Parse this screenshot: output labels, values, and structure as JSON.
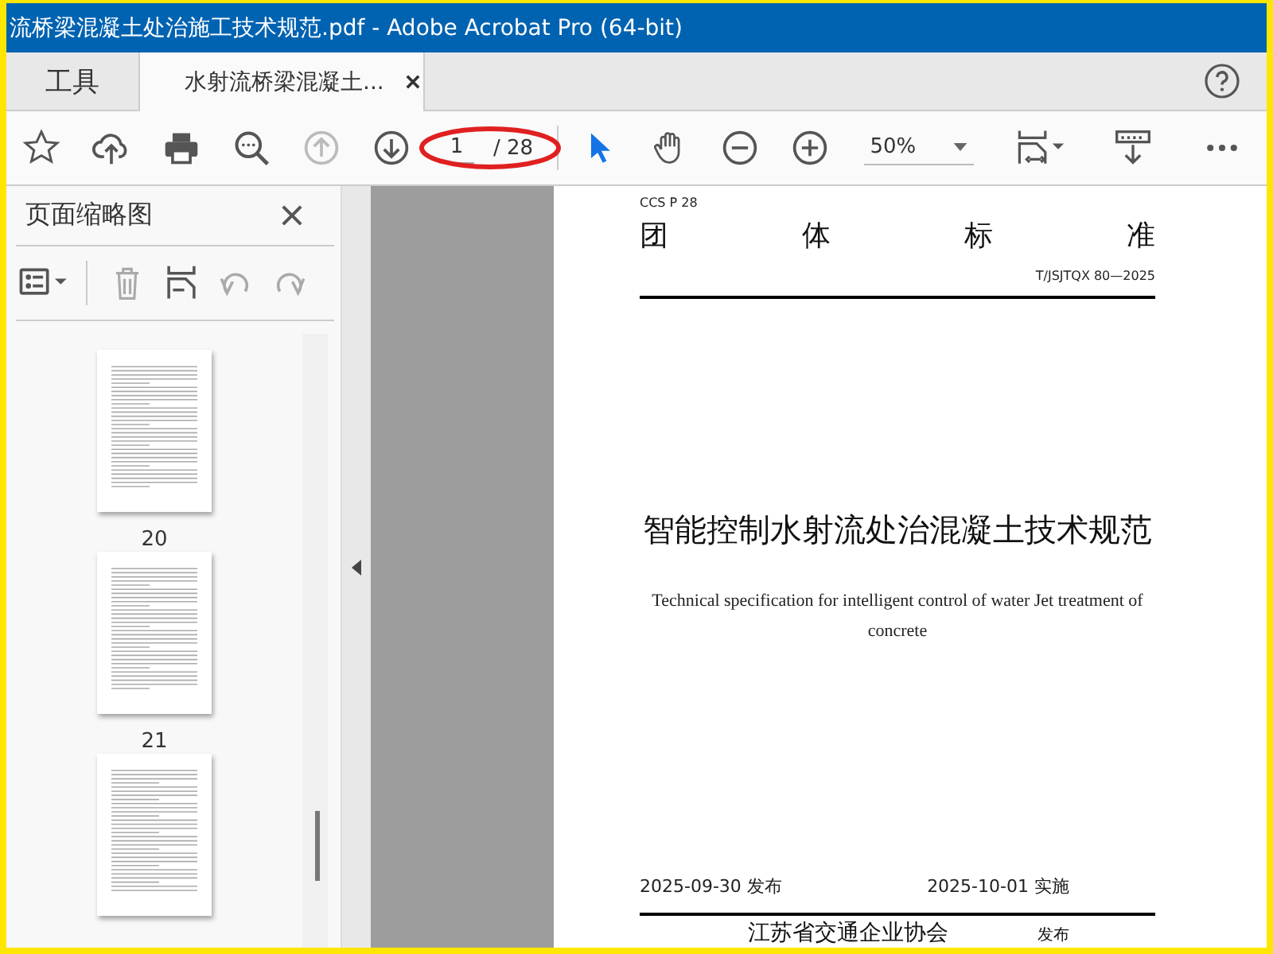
{
  "window": {
    "title": "流桥梁混凝土处治施工技术规范.pdf - Adobe Acrobat Pro (64-bit)"
  },
  "tabs": [
    {
      "label": "工具",
      "selected": false,
      "closable": false
    },
    {
      "label": "水射流桥梁混凝土...",
      "selected": true,
      "closable": true
    }
  ],
  "toolbar": {
    "left_tools": [
      {
        "kind": "star",
        "disabled": false
      },
      {
        "kind": "upload",
        "disabled": false
      },
      {
        "kind": "print",
        "disabled": false
      },
      {
        "kind": "search",
        "disabled": false
      },
      {
        "kind": "prev",
        "disabled": true
      },
      {
        "kind": "next",
        "disabled": false
      }
    ],
    "page": {
      "value": "1",
      "total": "/ 28",
      "circled": true
    },
    "right_tools": [
      {
        "kind": "pointer",
        "selected": true
      },
      {
        "kind": "hand",
        "selected": false
      },
      {
        "kind": "zoom-out",
        "selected": false
      },
      {
        "kind": "zoom-in",
        "selected": false
      }
    ],
    "zoom": {
      "value": "50%"
    },
    "end_tools": [
      {
        "kind": "fit"
      },
      {
        "kind": "ruler"
      },
      {
        "kind": "more"
      }
    ]
  },
  "sidebar": {
    "title": "页面缩略图",
    "tools": [
      {
        "kind": "options",
        "disabled": false
      },
      {
        "kind": "delete",
        "disabled": true
      },
      {
        "kind": "insert",
        "disabled": false
      },
      {
        "kind": "undo",
        "disabled": true
      },
      {
        "kind": "redo",
        "disabled": true
      }
    ],
    "thumbnails": [
      {
        "label": "20"
      },
      {
        "label": "21"
      }
    ],
    "next_thumbnail_partly_shown": true
  },
  "document": {
    "code": "CCS P 28",
    "heading": "团 体 标 准",
    "number": "T/JSJTQX 80—2025",
    "title": "智能控制水射流处治混凝土技术规范",
    "subtitle": "Technical specification for intelligent control of water Jet treatment of concrete",
    "issued": "2025-09-30 发布",
    "effective": "2025-10-01 实施",
    "publisher": "江苏省交通企业协会",
    "publisher_action": "发布"
  }
}
